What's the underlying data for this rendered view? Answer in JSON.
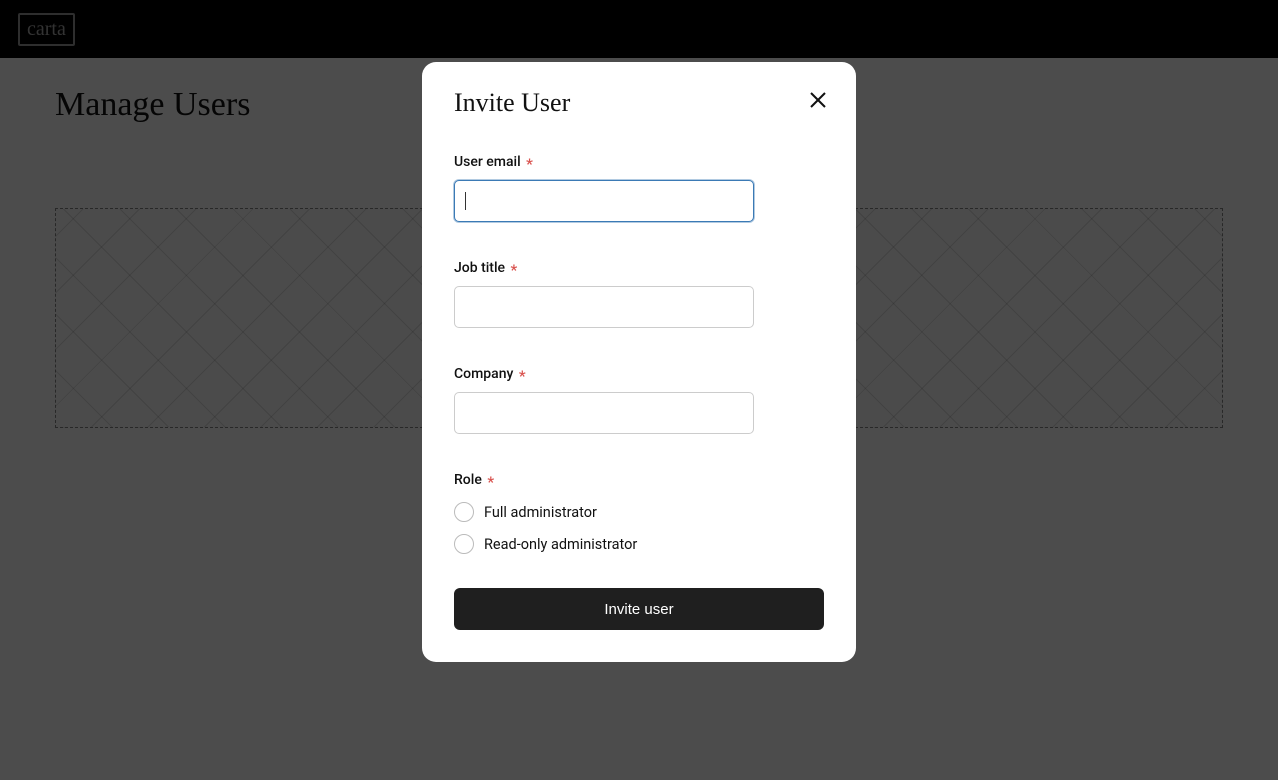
{
  "header": {
    "logo": "carta"
  },
  "page": {
    "title": "Manage Users"
  },
  "modal": {
    "title": "Invite User",
    "fields": {
      "email": {
        "label": "User email",
        "value": ""
      },
      "job_title": {
        "label": "Job title",
        "value": ""
      },
      "company": {
        "label": "Company",
        "value": ""
      },
      "role": {
        "label": "Role",
        "options": [
          "Full administrator",
          "Read-only administrator"
        ]
      }
    },
    "submit_label": "Invite user"
  }
}
